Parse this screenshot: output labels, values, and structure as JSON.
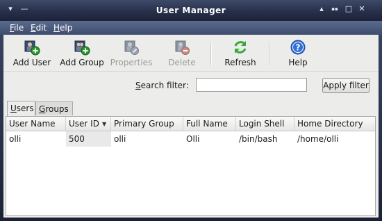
{
  "window": {
    "title": "User Manager",
    "controls": [
      "▾",
      "—"
    ],
    "right_controls": [
      "▴",
      "▪▪",
      "□",
      "✕"
    ]
  },
  "menubar": {
    "file": {
      "mnemonic": "F",
      "rest": "ile"
    },
    "edit": {
      "mnemonic": "E",
      "rest": "dit"
    },
    "help": {
      "mnemonic": "H",
      "rest": "elp"
    }
  },
  "toolbar": {
    "add_user": "Add User",
    "add_group": "Add Group",
    "properties": "Properties",
    "delete": "Delete",
    "refresh": "Refresh",
    "help": "Help"
  },
  "filter": {
    "label_mnemonic": "S",
    "label_rest": "earch filter:",
    "value": "",
    "apply": "Apply filter"
  },
  "tabs": [
    {
      "mnemonic": "U",
      "rest": "sers",
      "active": true
    },
    {
      "mnemonic": "G",
      "rest": "roups",
      "active": false
    }
  ],
  "table": {
    "columns": [
      "User Name",
      "User ID",
      "Primary Group",
      "Full Name",
      "Login Shell",
      "Home Directory"
    ],
    "sorted_column": "User ID",
    "rows": [
      [
        "olli",
        "500",
        "olli",
        "Olli",
        "/bin/bash",
        "/home/olli"
      ]
    ]
  },
  "colors": {
    "titlebar": "#27304a",
    "menubar": "#4c5c7e",
    "add_badge": "#2a9a2a",
    "delete_badge": "#c0392b",
    "refresh": "#3aa63a",
    "help": "#2f6fd6"
  }
}
